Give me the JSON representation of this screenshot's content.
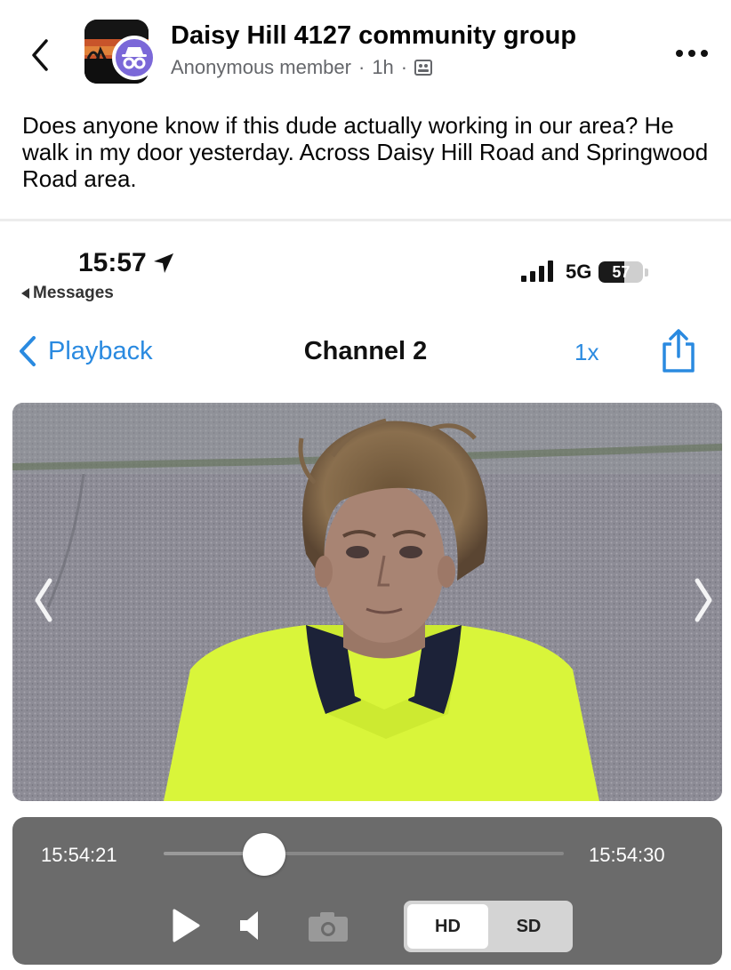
{
  "post": {
    "group_name": "Daisy Hill 4127 community group",
    "author": "Anonymous member",
    "separator": "·",
    "age": "1h",
    "body": "Does anyone know if this dude actually working in our area? He walk in my door yesterday. Across Daisy Hill Road and Springwood Road area."
  },
  "icons": {
    "back": "chevron-left-icon",
    "avatar_badge": "incognito-icon",
    "privacy": "members-icon",
    "more": "more-dots-icon"
  },
  "phone": {
    "status": {
      "time": "15:57",
      "back_app": "Messages",
      "network": "5G",
      "battery_level": "57",
      "battery_fraction": 0.57
    },
    "nav": {
      "back_label": "Playback",
      "title": "Channel 2",
      "speed": "1x"
    },
    "player": {
      "start_time": "15:54:21",
      "end_time": "15:54:30",
      "progress": 0.25,
      "quality_options": [
        "HD",
        "SD"
      ],
      "quality_selected": "HD"
    }
  },
  "colors": {
    "accent": "#2a8ae0",
    "meta_text": "#65676b",
    "controls_bg": "#6b6b6b",
    "badge": "#7b68d8",
    "vest": "#d9f53a"
  }
}
